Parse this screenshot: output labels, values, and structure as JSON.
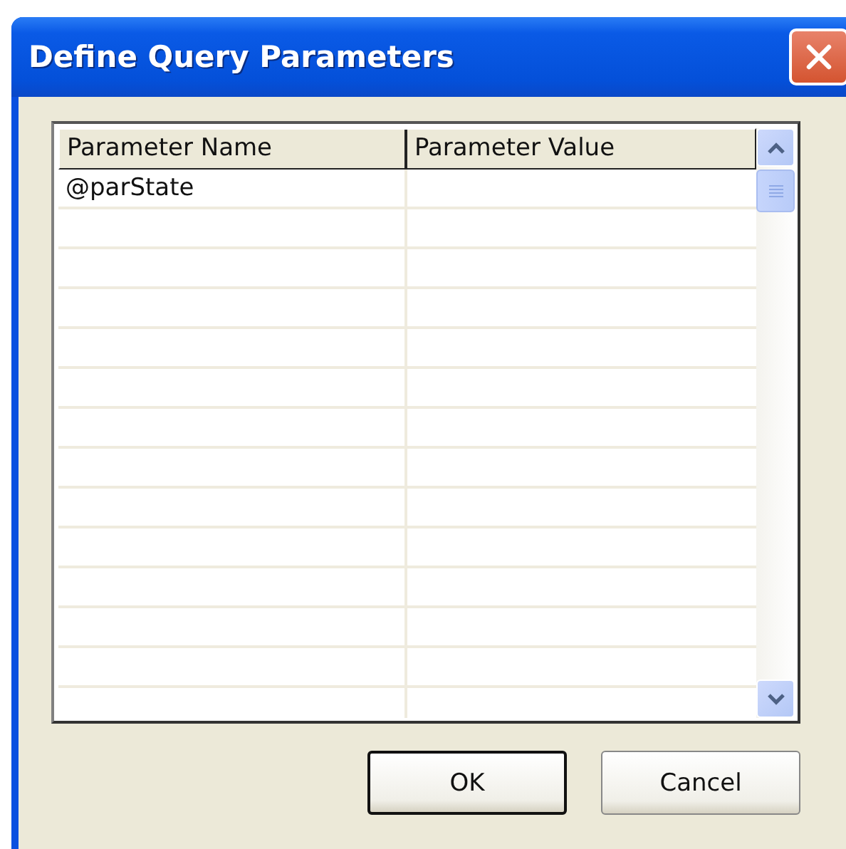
{
  "window": {
    "title": "Define Query Parameters"
  },
  "table": {
    "columns": [
      "Parameter Name",
      "Parameter Value"
    ],
    "rows": [
      {
        "name": "@parState",
        "value": ""
      }
    ]
  },
  "buttons": [
    {
      "label": "OK",
      "default": true
    },
    {
      "label": "Cancel",
      "default": false
    }
  ]
}
